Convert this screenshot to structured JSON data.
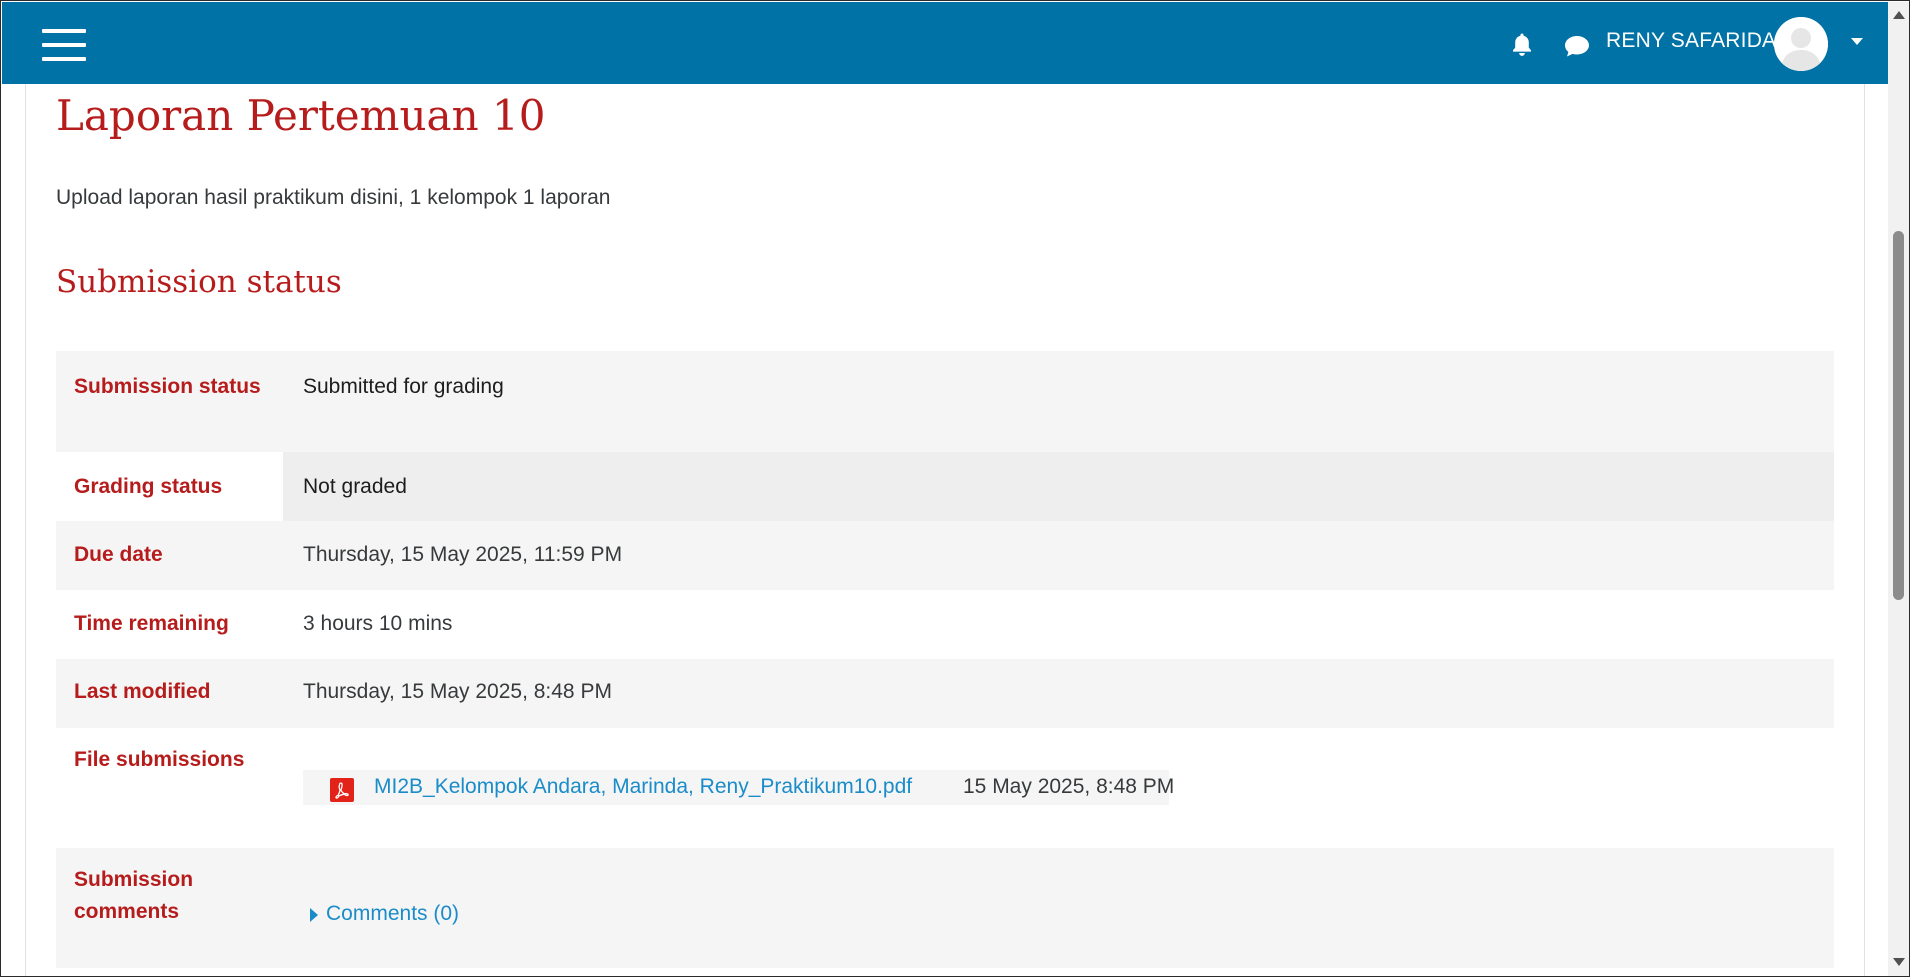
{
  "header": {
    "username": "RENY SAFARIDA",
    "icons": {
      "menu": "hamburger-icon",
      "notifications": "bell-icon",
      "messages": "chat-icon",
      "user_menu": "chevron-down-icon"
    },
    "background_color": "#0072a5"
  },
  "page": {
    "title": "Laporan Pertemuan 10",
    "intro": "Upload laporan hasil praktikum disini, 1 kelompok 1 laporan",
    "section_title": "Submission status",
    "accent_color": "#b71c1c",
    "link_color": "#1a8cc9"
  },
  "status_table": {
    "submission_status_label": "Submission status",
    "submission_status_value": "Submitted for grading",
    "grading_status_label": "Grading status",
    "grading_status_value": "Not graded",
    "due_date_label": "Due date",
    "due_date_value": "Thursday, 15 May 2025, 11:59 PM",
    "time_remaining_label": "Time remaining",
    "time_remaining_value": "3 hours 10 mins",
    "last_modified_label": "Last modified",
    "last_modified_value": "Thursday, 15 May 2025, 8:48 PM",
    "file_submissions_label": "File submissions",
    "file": {
      "name": "MI2B_Kelompok Andara, Marinda, Reny_Praktikum10.pdf",
      "date": "15 May 2025, 8:48 PM",
      "icon": "pdf-icon"
    },
    "submission_comments_label": "Submission comments",
    "comments_link": "Comments (0)"
  }
}
